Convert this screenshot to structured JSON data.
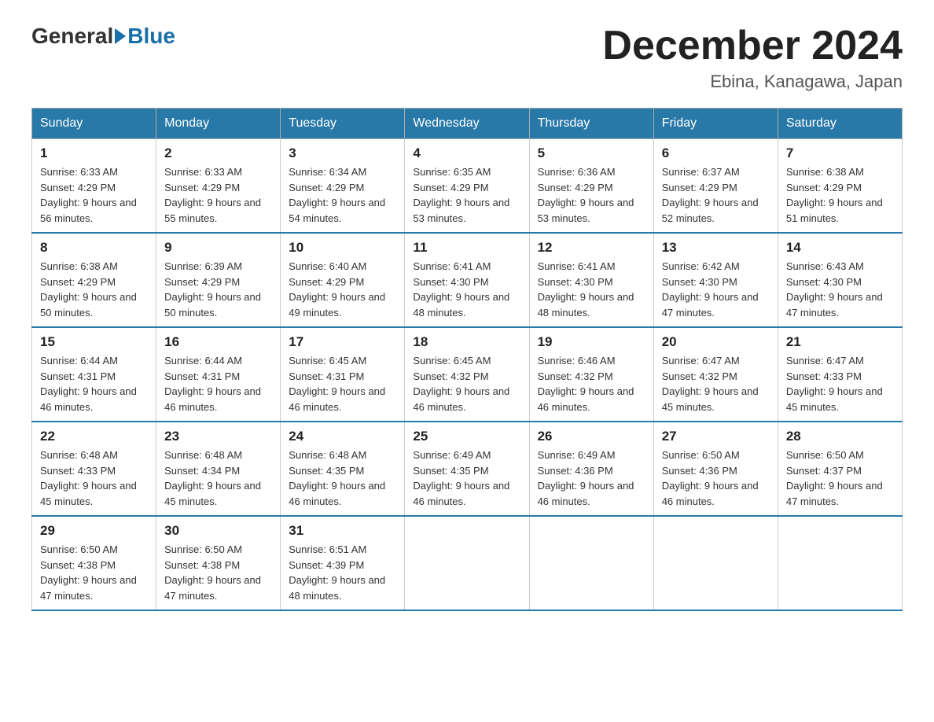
{
  "header": {
    "logo_general": "General",
    "logo_blue": "Blue",
    "month_title": "December 2024",
    "location": "Ebina, Kanagawa, Japan"
  },
  "days_of_week": [
    "Sunday",
    "Monday",
    "Tuesday",
    "Wednesday",
    "Thursday",
    "Friday",
    "Saturday"
  ],
  "weeks": [
    [
      {
        "day": 1,
        "sunrise": "6:33 AM",
        "sunset": "4:29 PM",
        "daylight": "9 hours and 56 minutes."
      },
      {
        "day": 2,
        "sunrise": "6:33 AM",
        "sunset": "4:29 PM",
        "daylight": "9 hours and 55 minutes."
      },
      {
        "day": 3,
        "sunrise": "6:34 AM",
        "sunset": "4:29 PM",
        "daylight": "9 hours and 54 minutes."
      },
      {
        "day": 4,
        "sunrise": "6:35 AM",
        "sunset": "4:29 PM",
        "daylight": "9 hours and 53 minutes."
      },
      {
        "day": 5,
        "sunrise": "6:36 AM",
        "sunset": "4:29 PM",
        "daylight": "9 hours and 53 minutes."
      },
      {
        "day": 6,
        "sunrise": "6:37 AM",
        "sunset": "4:29 PM",
        "daylight": "9 hours and 52 minutes."
      },
      {
        "day": 7,
        "sunrise": "6:38 AM",
        "sunset": "4:29 PM",
        "daylight": "9 hours and 51 minutes."
      }
    ],
    [
      {
        "day": 8,
        "sunrise": "6:38 AM",
        "sunset": "4:29 PM",
        "daylight": "9 hours and 50 minutes."
      },
      {
        "day": 9,
        "sunrise": "6:39 AM",
        "sunset": "4:29 PM",
        "daylight": "9 hours and 50 minutes."
      },
      {
        "day": 10,
        "sunrise": "6:40 AM",
        "sunset": "4:29 PM",
        "daylight": "9 hours and 49 minutes."
      },
      {
        "day": 11,
        "sunrise": "6:41 AM",
        "sunset": "4:30 PM",
        "daylight": "9 hours and 48 minutes."
      },
      {
        "day": 12,
        "sunrise": "6:41 AM",
        "sunset": "4:30 PM",
        "daylight": "9 hours and 48 minutes."
      },
      {
        "day": 13,
        "sunrise": "6:42 AM",
        "sunset": "4:30 PM",
        "daylight": "9 hours and 47 minutes."
      },
      {
        "day": 14,
        "sunrise": "6:43 AM",
        "sunset": "4:30 PM",
        "daylight": "9 hours and 47 minutes."
      }
    ],
    [
      {
        "day": 15,
        "sunrise": "6:44 AM",
        "sunset": "4:31 PM",
        "daylight": "9 hours and 46 minutes."
      },
      {
        "day": 16,
        "sunrise": "6:44 AM",
        "sunset": "4:31 PM",
        "daylight": "9 hours and 46 minutes."
      },
      {
        "day": 17,
        "sunrise": "6:45 AM",
        "sunset": "4:31 PM",
        "daylight": "9 hours and 46 minutes."
      },
      {
        "day": 18,
        "sunrise": "6:45 AM",
        "sunset": "4:32 PM",
        "daylight": "9 hours and 46 minutes."
      },
      {
        "day": 19,
        "sunrise": "6:46 AM",
        "sunset": "4:32 PM",
        "daylight": "9 hours and 46 minutes."
      },
      {
        "day": 20,
        "sunrise": "6:47 AM",
        "sunset": "4:32 PM",
        "daylight": "9 hours and 45 minutes."
      },
      {
        "day": 21,
        "sunrise": "6:47 AM",
        "sunset": "4:33 PM",
        "daylight": "9 hours and 45 minutes."
      }
    ],
    [
      {
        "day": 22,
        "sunrise": "6:48 AM",
        "sunset": "4:33 PM",
        "daylight": "9 hours and 45 minutes."
      },
      {
        "day": 23,
        "sunrise": "6:48 AM",
        "sunset": "4:34 PM",
        "daylight": "9 hours and 45 minutes."
      },
      {
        "day": 24,
        "sunrise": "6:48 AM",
        "sunset": "4:35 PM",
        "daylight": "9 hours and 46 minutes."
      },
      {
        "day": 25,
        "sunrise": "6:49 AM",
        "sunset": "4:35 PM",
        "daylight": "9 hours and 46 minutes."
      },
      {
        "day": 26,
        "sunrise": "6:49 AM",
        "sunset": "4:36 PM",
        "daylight": "9 hours and 46 minutes."
      },
      {
        "day": 27,
        "sunrise": "6:50 AM",
        "sunset": "4:36 PM",
        "daylight": "9 hours and 46 minutes."
      },
      {
        "day": 28,
        "sunrise": "6:50 AM",
        "sunset": "4:37 PM",
        "daylight": "9 hours and 47 minutes."
      }
    ],
    [
      {
        "day": 29,
        "sunrise": "6:50 AM",
        "sunset": "4:38 PM",
        "daylight": "9 hours and 47 minutes."
      },
      {
        "day": 30,
        "sunrise": "6:50 AM",
        "sunset": "4:38 PM",
        "daylight": "9 hours and 47 minutes."
      },
      {
        "day": 31,
        "sunrise": "6:51 AM",
        "sunset": "4:39 PM",
        "daylight": "9 hours and 48 minutes."
      },
      null,
      null,
      null,
      null
    ]
  ],
  "labels": {
    "sunrise_prefix": "Sunrise: ",
    "sunset_prefix": "Sunset: ",
    "daylight_prefix": "Daylight: "
  }
}
